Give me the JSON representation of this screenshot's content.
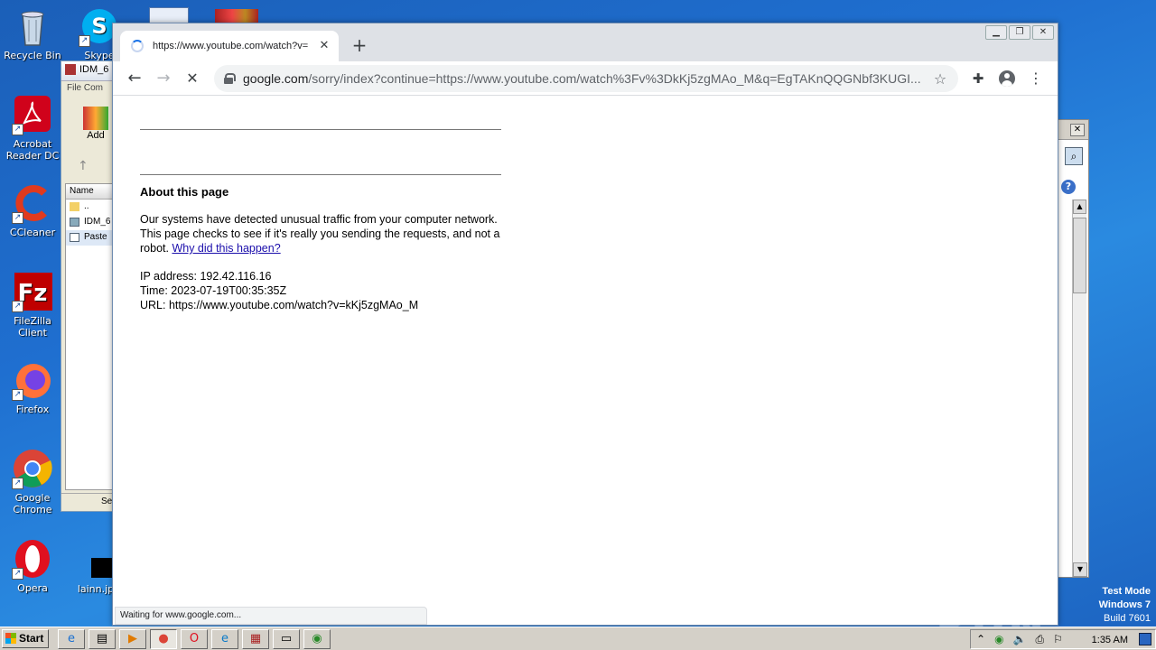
{
  "desktop": {
    "icons": [
      {
        "label": "Recycle Bin"
      },
      {
        "label": "Skype"
      },
      {
        "label": "Acrobat Reader DC"
      },
      {
        "label": "CCleaner"
      },
      {
        "label": "FileZilla Client"
      },
      {
        "label": "Firefox"
      },
      {
        "label": "Google Chrome"
      },
      {
        "label": "Opera"
      },
      {
        "label": "lainn.jp"
      }
    ]
  },
  "winrar": {
    "title": "IDM_6",
    "menu": "File  Com",
    "add_label": "Add",
    "column_name": "Name",
    "rows": [
      "..",
      "IDM_6",
      "Paste"
    ],
    "status": "Se"
  },
  "chrome": {
    "tab_title": "https://www.youtube.com/watch?v=",
    "address": {
      "host": "google.com",
      "path": "/sorry/index?continue=https://www.youtube.com/watch%3Fv%3DkKj5zgMAo_M&q=EgTAKnQQGNbf3KUGI..."
    },
    "status_text": "Waiting for www.google.com..."
  },
  "page": {
    "heading": "About this page",
    "para1": "Our systems have detected unusual traffic from your computer network. This page checks to see if it's really you sending the requests, and not a robot.",
    "link": "Why did this happen?",
    "ip": "IP address: 192.42.116.16",
    "time": "Time: 2023-07-19T00:35:35Z",
    "url": "URL: https://www.youtube.com/watch?v=kKj5zgMAo_M"
  },
  "watermark": "ANY RUN",
  "test_mode": {
    "line1": "Test Mode",
    "line2": "Windows 7",
    "line3": "Build 7601"
  },
  "taskbar": {
    "start_label": "Start",
    "clock": "1:35 AM"
  }
}
